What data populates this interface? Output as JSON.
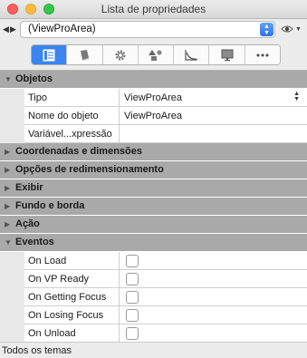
{
  "window": {
    "title": "Lista de propriedades"
  },
  "selector": {
    "value": "(ViewProArea)"
  },
  "tabs": [
    {
      "icon": "properties-list-icon",
      "active": true
    },
    {
      "icon": "book-icon",
      "active": false
    },
    {
      "icon": "gear-icon",
      "active": false
    },
    {
      "icon": "shapes-icon",
      "active": false
    },
    {
      "icon": "graph-icon",
      "active": false
    },
    {
      "icon": "monitor-icon",
      "active": false
    },
    {
      "icon": "more-icon",
      "active": false
    }
  ],
  "groups": {
    "objetos": "Objetos",
    "coordenadas": "Coordenadas e dimensões",
    "redimensionamento": "Opções de redimensionamento",
    "exibir": "Exibir",
    "fundo": "Fundo e borda",
    "acao": "Ação",
    "eventos": "Eventos"
  },
  "properties": {
    "tipo": {
      "label": "Tipo",
      "value": "ViewProArea"
    },
    "nome": {
      "label": "Nome do objeto",
      "value": "ViewProArea"
    },
    "variavel": {
      "label": "Variável...xpressão",
      "value": ""
    }
  },
  "events": [
    {
      "label": "On Load",
      "checked": false
    },
    {
      "label": "On VP Ready",
      "checked": false
    },
    {
      "label": "On Getting Focus",
      "checked": false
    },
    {
      "label": "On Losing Focus",
      "checked": false
    },
    {
      "label": "On Unload",
      "checked": false
    }
  ],
  "status": {
    "text": "Todos os temas"
  },
  "colors": {
    "active_tab": "#3b85f0",
    "group_header": "#a9a9a9"
  }
}
